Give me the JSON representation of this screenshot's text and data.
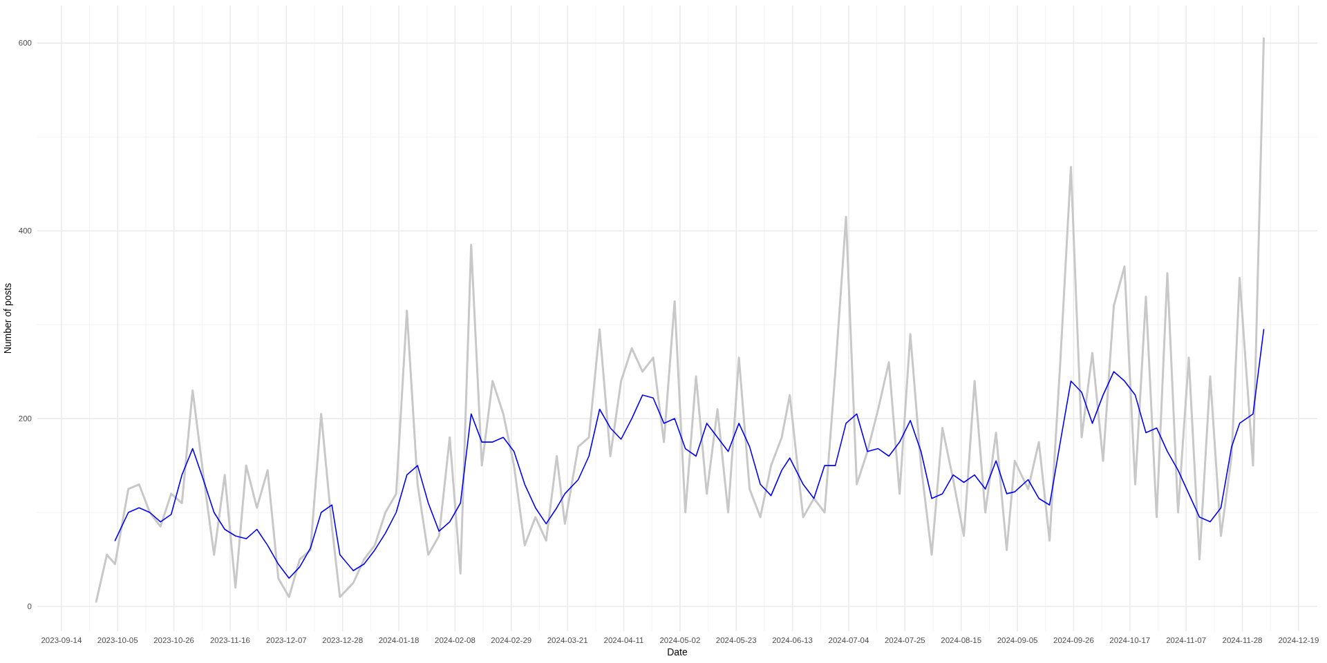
{
  "chart_data": {
    "type": "line",
    "xlabel": "Date",
    "ylabel": "Number of posts",
    "x": [
      "2023-09-27",
      "2023-10-01",
      "2023-10-04",
      "2023-10-09",
      "2023-10-13",
      "2023-10-17",
      "2023-10-21",
      "2023-10-25",
      "2023-10-29",
      "2023-11-02",
      "2023-11-06",
      "2023-11-10",
      "2023-11-14",
      "2023-11-18",
      "2023-11-22",
      "2023-11-26",
      "2023-11-30",
      "2023-12-04",
      "2023-12-08",
      "2023-12-12",
      "2023-12-16",
      "2023-12-20",
      "2023-12-24",
      "2023-12-27",
      "2024-01-01",
      "2024-01-05",
      "2024-01-09",
      "2024-01-13",
      "2024-01-17",
      "2024-01-21",
      "2024-01-25",
      "2024-01-29",
      "2024-02-02",
      "2024-02-06",
      "2024-02-10",
      "2024-02-14",
      "2024-02-18",
      "2024-02-22",
      "2024-02-26",
      "2024-03-01",
      "2024-03-05",
      "2024-03-09",
      "2024-03-13",
      "2024-03-17",
      "2024-03-20",
      "2024-03-25",
      "2024-03-29",
      "2024-04-02",
      "2024-04-06",
      "2024-04-10",
      "2024-04-14",
      "2024-04-18",
      "2024-04-22",
      "2024-04-26",
      "2024-04-30",
      "2024-05-04",
      "2024-05-08",
      "2024-05-12",
      "2024-05-16",
      "2024-05-20",
      "2024-05-24",
      "2024-05-28",
      "2024-06-01",
      "2024-06-05",
      "2024-06-09",
      "2024-06-12",
      "2024-06-17",
      "2024-06-21",
      "2024-06-25",
      "2024-06-29",
      "2024-07-03",
      "2024-07-07",
      "2024-07-11",
      "2024-07-15",
      "2024-07-19",
      "2024-07-23",
      "2024-07-27",
      "2024-07-31",
      "2024-08-04",
      "2024-08-08",
      "2024-08-12",
      "2024-08-16",
      "2024-08-20",
      "2024-08-24",
      "2024-08-28",
      "2024-09-01",
      "2024-09-04",
      "2024-09-09",
      "2024-09-13",
      "2024-09-17",
      "2024-09-21",
      "2024-09-25",
      "2024-09-29",
      "2024-10-03",
      "2024-10-07",
      "2024-10-11",
      "2024-10-15",
      "2024-10-19",
      "2024-10-23",
      "2024-10-27",
      "2024-10-31",
      "2024-11-04",
      "2024-11-08",
      "2024-11-12",
      "2024-11-16",
      "2024-11-20",
      "2024-11-24",
      "2024-11-27",
      "2024-12-02",
      "2024-12-06"
    ],
    "series": [
      {
        "color": "#c8c8c8",
        "values": [
          5,
          55,
          45,
          125,
          130,
          100,
          85,
          120,
          110,
          230,
          140,
          55,
          140,
          20,
          150,
          105,
          145,
          30,
          10,
          50,
          60,
          205,
          85,
          10,
          25,
          50,
          65,
          100,
          120,
          315,
          130,
          55,
          75,
          180,
          35,
          385,
          150,
          240,
          205,
          150,
          65,
          95,
          70,
          160,
          88,
          170,
          180,
          295,
          160,
          240,
          275,
          250,
          265,
          175,
          325,
          100,
          245,
          120,
          210,
          100,
          265,
          125,
          95,
          150,
          180,
          225,
          95,
          115,
          100,
          250,
          415,
          130,
          165,
          210,
          260,
          120,
          290,
          150,
          55,
          190,
          135,
          75,
          240,
          100,
          185,
          60,
          155,
          125,
          175,
          70,
          260,
          468,
          180,
          270,
          155,
          320,
          362,
          130,
          330,
          95,
          355,
          100,
          265,
          50,
          245,
          75,
          160,
          350,
          150,
          605
        ]
      },
      {
        "color": "#0000ff",
        "values": [
          null,
          null,
          70,
          100,
          105,
          100,
          90,
          98,
          140,
          168,
          135,
          100,
          82,
          75,
          72,
          82,
          65,
          45,
          30,
          42,
          62,
          100,
          108,
          55,
          38,
          45,
          60,
          78,
          100,
          140,
          150,
          110,
          80,
          90,
          110,
          205,
          175,
          175,
          180,
          165,
          130,
          105,
          88,
          105,
          120,
          135,
          160,
          210,
          190,
          178,
          200,
          225,
          222,
          195,
          200,
          168,
          160,
          195,
          180,
          165,
          195,
          170,
          130,
          118,
          145,
          158,
          130,
          115,
          150,
          150,
          195,
          205,
          165,
          168,
          160,
          175,
          198,
          165,
          115,
          120,
          140,
          132,
          140,
          125,
          155,
          120,
          122,
          135,
          115,
          108,
          175,
          240,
          228,
          195,
          225,
          250,
          240,
          225,
          185,
          190,
          165,
          145,
          120,
          95,
          90,
          105,
          170,
          195,
          205,
          295
        ]
      }
    ],
    "xlim": [
      "2023-09-05",
      "2024-12-26"
    ],
    "ylim": [
      -26.5,
      640
    ],
    "xticks": [
      "2023-09-14",
      "2023-10-05",
      "2023-10-26",
      "2023-11-16",
      "2023-12-07",
      "2023-12-28",
      "2024-01-18",
      "2024-02-08",
      "2024-02-29",
      "2024-03-21",
      "2024-04-11",
      "2024-05-02",
      "2024-05-23",
      "2024-06-13",
      "2024-07-04",
      "2024-07-25",
      "2024-08-15",
      "2024-09-05",
      "2024-09-26",
      "2024-10-17",
      "2024-11-07",
      "2024-11-28",
      "2024-12-19"
    ],
    "yticks": [
      0,
      200,
      400,
      600
    ],
    "grid": true
  }
}
